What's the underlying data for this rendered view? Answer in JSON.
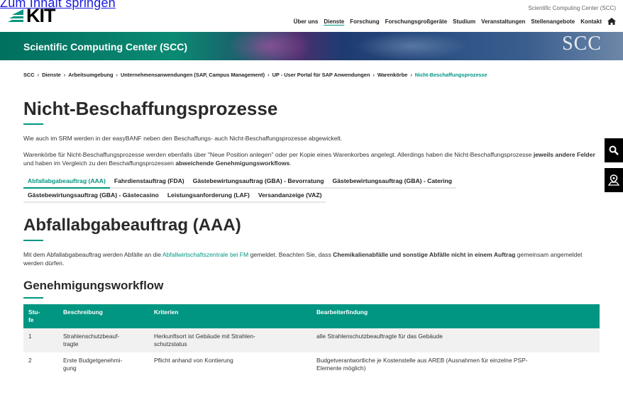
{
  "skip_link": "Zum Inhalt springen",
  "logo": {
    "text": "KIT"
  },
  "header": {
    "org": "Scientific Computing Center (SCC)",
    "nav": [
      "Über uns",
      "Dienste",
      "Forschung",
      "Forschungsgroßgeräte",
      "Studium",
      "Veranstaltungen",
      "Stellenangebote",
      "Kontakt"
    ],
    "active_nav": "Dienste"
  },
  "banner": {
    "title": "Scientific Computing Center (SCC)",
    "mark": "SCC"
  },
  "breadcrumb": [
    "SCC",
    "Dienste",
    "Arbeitsumgebung",
    "Unternehmensanwendungen (SAP, Campus Management)",
    "UP - User Portal für SAP Anwendungen",
    "Warenkörbe",
    "Nicht-Beschaffungsprozesse"
  ],
  "page": {
    "title": "Nicht-Beschaffungsprozesse",
    "intro": "Wie auch im SRM werden in der easyBANF neben den Beschaffungs- auch Nicht-Beschaffungsprozesse abgewickelt.",
    "para2_a": "Warenkörbe für Nicht-Beschaffungsprozesse werden ebenfalls über \"Neue Position anlegen\" oder per Kopie eines Warenkorbes angelegt. Allerdings haben die Nicht-Beschaffungsprozesse ",
    "para2_b": "jeweils andere Felder",
    "para2_c": " und haben im Vergleich zu den Beschaffungsprozessen ",
    "para2_d": "abweichende Genehmigungsworkflows",
    "para2_e": "."
  },
  "tabs": [
    {
      "label": "Abfallabgabeauftrag (AAA)",
      "active": true
    },
    {
      "label": "Fahrdienstauftrag (FDA)",
      "active": false
    },
    {
      "label": "Gästebewirtungsauftrag (GBA) - Bevorratung",
      "active": false
    },
    {
      "label": "Gästebewirtungsauftrag (GBA) - Catering",
      "active": false
    },
    {
      "label": "Gästebewirtungsauftrag (GBA) - Gästecasino",
      "active": false
    },
    {
      "label": "Leistungsanforderung (LAF)",
      "active": false
    },
    {
      "label": "Versandanzeige (VAZ)",
      "active": false
    }
  ],
  "section": {
    "title": "Abfallabgabeauftrag (AAA)",
    "text_a": "Mit dem Abfallabgabeauftrag werden Abfälle an die ",
    "link": "Abfallwirtschaftszentrale bei FM",
    "text_b": " gemeldet. Beachten Sie, dass ",
    "bold": "Chemikalienabfälle und sonstige Abfälle nicht in einem Auftrag",
    "text_c": " gemeinsam angemeldet werden dürfen.",
    "subtitle": "Genehmigungsworkflow"
  },
  "table": {
    "headers": [
      "Stu-\nfe",
      "Beschreibung",
      "Kriterien",
      "Bearbeiterfindung"
    ],
    "rows": [
      [
        "1",
        "Strahlenschutzbeauf-\ntragte",
        "Herkunftsort ist Gebäude mit Strahlen-\nschutzstatus",
        "alle Strahlenschutzbeauftragte für das Gebäude"
      ],
      [
        "2",
        "Erste Budgetgenehmi-\ngung",
        "Pflicht anhand von Kontierung",
        "Budgetverantwortliche je Kostenstelle aus AREB (Ausnahmen für einzelne PSP-\nElemente möglich)"
      ]
    ]
  },
  "colors": {
    "accent": "#009682",
    "side_buttons": "#000000"
  },
  "icons": [
    "search-icon",
    "map-pin-icon",
    "home-icon"
  ]
}
